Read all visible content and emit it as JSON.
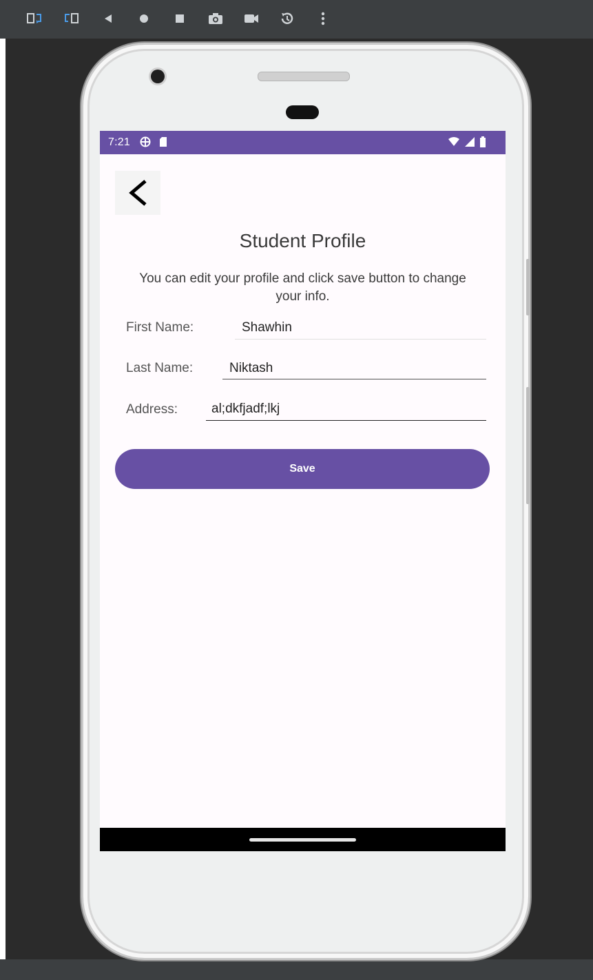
{
  "toolbar": {
    "icons": [
      "rotate-left-icon",
      "rotate-right-icon",
      "back-icon",
      "home-icon",
      "overview-icon",
      "screenshot-icon",
      "screen-record-icon",
      "snapshot-icon",
      "more-icon"
    ]
  },
  "status_bar": {
    "time": "7:21",
    "color": "#6750a4"
  },
  "screen": {
    "title": "Student Profile",
    "description": "You can edit your profile and click save button to change your info.",
    "fields": [
      {
        "label": "First Name:",
        "value": "Shawhin"
      },
      {
        "label": "Last Name:",
        "value": "Niktash"
      },
      {
        "label": "Address:",
        "value": "al;dkfjadf;lkj"
      }
    ],
    "save_label": "Save"
  },
  "colors": {
    "accent": "#6750a4",
    "background": "#fffbfe",
    "emulator_bg": "#2b2b2b"
  }
}
